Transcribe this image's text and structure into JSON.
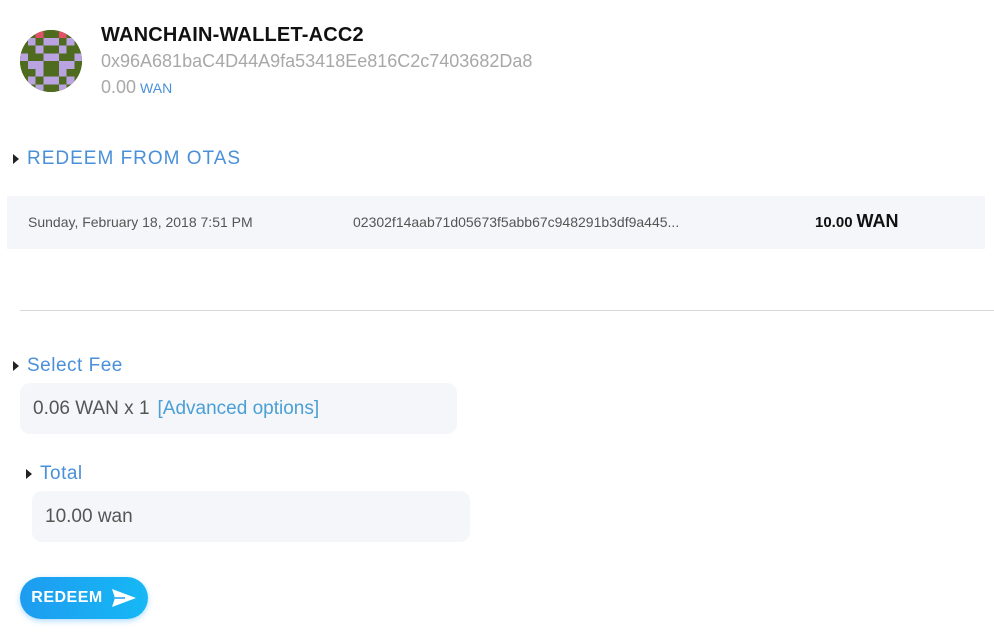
{
  "account": {
    "name": "WANCHAIN-WALLET-ACC2",
    "address": "0x96A681baC4D44A9fa53418Ee816C2c7403682Da8",
    "balance": "0.00",
    "balance_unit": "WAN",
    "avatar_icon": "identicon-avatar"
  },
  "otas": {
    "heading": "REDEEM FROM OTAS",
    "rows": [
      {
        "date": "Sunday, February 18, 2018 7:51 PM",
        "hash": "02302f14aab71d05673f5abb67c948291b3df9a445...",
        "amount": "10.00",
        "unit": "WAN"
      }
    ]
  },
  "fee": {
    "heading": "Select Fee",
    "value": "0.06 WAN x 1",
    "advanced_label": "[Advanced options]"
  },
  "total": {
    "heading": "Total",
    "value": "10.00 wan"
  },
  "redeem_button": {
    "label": "REDEEM",
    "icon": "send-icon"
  },
  "colors": {
    "accent": "#4a90d9",
    "link": "#4a9fd5",
    "button": "#1e9cf0",
    "field_bg": "#f4f6f9"
  }
}
